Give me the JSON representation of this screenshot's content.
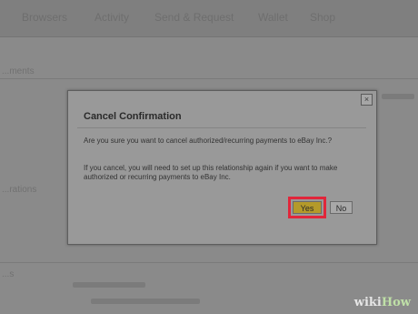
{
  "background": {
    "nav": [
      "Browsers",
      "Activity",
      "Send & Request",
      "Wallet",
      "Shop"
    ],
    "text_fragments": [
      "...ments",
      "...rations",
      "...s",
      "...ns"
    ]
  },
  "dialog": {
    "title": "Cancel Confirmation",
    "paragraph1": "Are you sure you want to cancel authorized/recurring payments to eBay Inc.?",
    "paragraph2": "If you cancel, you will need to set up this relationship again if you want to make authorized or recurring payments to eBay Inc.",
    "yes_label": "Yes",
    "no_label": "No",
    "close_glyph": "×"
  },
  "watermark": {
    "part1": "wiki",
    "part2": "How"
  },
  "colors": {
    "highlight": "#e1263a",
    "yes_button": "#b49a2a",
    "overlay": "#7c7c7c"
  }
}
